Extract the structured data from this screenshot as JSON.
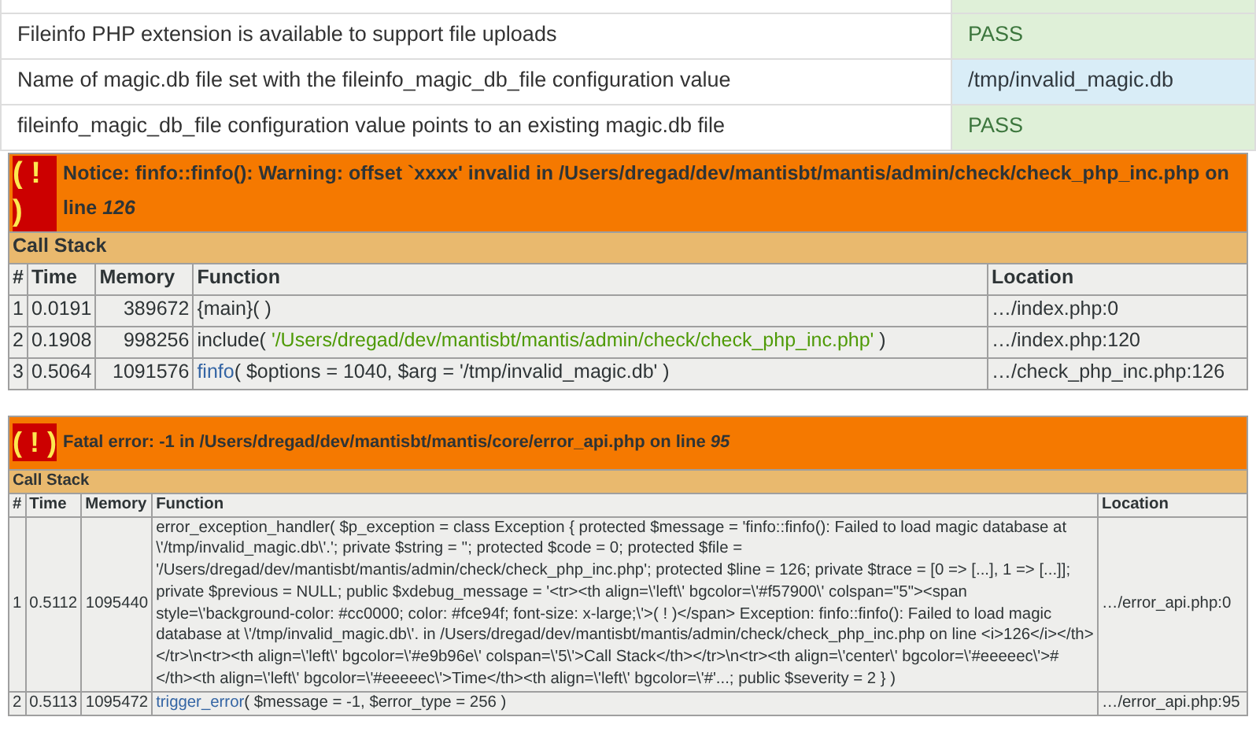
{
  "checks": [
    {
      "description": "Fileinfo PHP extension is available to support file uploads",
      "result": "PASS",
      "kind": "pass"
    },
    {
      "description": "Name of magic.db file set with the fileinfo_magic_db_file configuration value",
      "result": "/tmp/invalid_magic.db",
      "kind": "info"
    },
    {
      "description": "fileinfo_magic_db_file configuration value points to an existing magic.db file",
      "result": "PASS",
      "kind": "pass"
    }
  ],
  "errors": [
    {
      "marker": "( ! )",
      "message": "Notice: finfo::finfo(): Warning: offset `xxxx' invalid in /Users/dregad/dev/mantisbt/mantis/admin/check/check_php_inc.php on line *126*",
      "call_stack_title": "Call Stack",
      "columns": [
        "#",
        "Time",
        "Memory",
        "Function",
        "Location"
      ],
      "rows": [
        {
          "number": "1",
          "time": "0.0191",
          "memory": "389672",
          "function": [
            {
              "kind": "plain",
              "text": "{main}( )"
            }
          ],
          "location": "…/index.php:0"
        },
        {
          "number": "2",
          "time": "0.1908",
          "memory": "998256",
          "function": [
            {
              "kind": "plain",
              "text": "include( "
            },
            {
              "kind": "string",
              "text": "'/Users/dregad/dev/mantisbt/mantis/admin/check/check_php_inc.php'"
            },
            {
              "kind": "plain",
              "text": " )"
            }
          ],
          "location": "…/index.php:120"
        },
        {
          "number": "3",
          "time": "0.5064",
          "memory": "1091576",
          "function": [
            {
              "kind": "link",
              "text": "finfo"
            },
            {
              "kind": "plain",
              "text": "( $options = 1040, $arg = '/tmp/invalid_magic.db' )"
            }
          ],
          "location": "…/check_php_inc.php:126"
        }
      ]
    },
    {
      "marker": "( ! )",
      "message": "Fatal error: -1 in /Users/dregad/dev/mantisbt/mantis/core/error_api.php on line *95*",
      "call_stack_title": "Call Stack",
      "columns": [
        "#",
        "Time",
        "Memory",
        "Function",
        "Location"
      ],
      "rows": [
        {
          "number": "1",
          "time": "0.5112",
          "memory": "1095440",
          "function": [
            {
              "kind": "plain",
              "text": "error_exception_handler( $p_exception = class Exception { protected $message = 'finfo::finfo(): Failed to load magic database at \\'/tmp/invalid_magic.db\\'.'; private $string = ''; protected $code = 0; protected $file = '/Users/dregad/dev/mantisbt/mantis/admin/check/check_php_inc.php'; protected $line = 126; private $trace = [0 => [...], 1 => [...]]; private $previous = NULL; public $xdebug_message = '<tr><th align=\\'left\\' bgcolor=\\'#f57900\\' colspan=\"5\"><span style=\\'background-color: #cc0000; color: #fce94f; font-size: x-large;\\'>( ! )</span> Exception: finfo::finfo(): Failed to load magic database at \\'/tmp/invalid_magic.db\\'. in /Users/dregad/dev/mantisbt/mantis/admin/check/check_php_inc.php on line <i>126</i></th></tr>\\n<tr><th align=\\'left\\' bgcolor=\\'#e9b96e\\' colspan=\\'5\\'>Call Stack</th></tr>\\n<tr><th align=\\'center\\' bgcolor=\\'#eeeeec\\'>#</th><th align=\\'left\\' bgcolor=\\'#eeeeec\\'>Time</th><th align=\\'left\\' bgcolor=\\'#'...; public $severity = 2 } )"
            }
          ],
          "location": "…/error_api.php:0"
        },
        {
          "number": "2",
          "time": "0.5113",
          "memory": "1095472",
          "function": [
            {
              "kind": "link",
              "text": "trigger_error"
            },
            {
              "kind": "plain",
              "text": "( $message = -1, $error_type = 256 )"
            }
          ],
          "location": "…/error_api.php:95"
        }
      ]
    }
  ]
}
